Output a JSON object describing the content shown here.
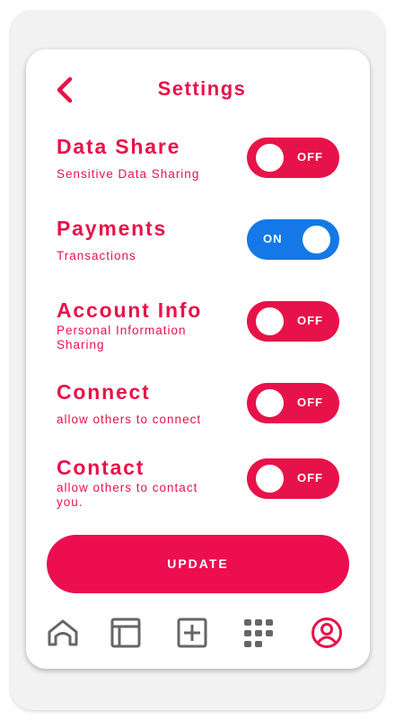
{
  "header": {
    "title": "Settings",
    "back_icon": "chevron-left-icon"
  },
  "settings": [
    {
      "title": "Data Share",
      "subtitle": "Sensitive Data Sharing",
      "state": "OFF"
    },
    {
      "title": "Payments",
      "subtitle": "Transactions",
      "state": "ON"
    },
    {
      "title": "Account Info",
      "subtitle": "Personal Information Sharing",
      "state": "OFF"
    },
    {
      "title": "Connect",
      "subtitle": "allow others to connect",
      "state": "OFF"
    },
    {
      "title": "Contact",
      "subtitle": "allow others to contact you.",
      "state": "OFF"
    }
  ],
  "update_label": "UPDATE",
  "bottom_nav": [
    {
      "icon": "home-icon",
      "active": false
    },
    {
      "icon": "layout-icon",
      "active": false
    },
    {
      "icon": "add-icon",
      "active": false
    },
    {
      "icon": "apps-grid-icon",
      "active": false
    },
    {
      "icon": "profile-icon",
      "active": true
    }
  ],
  "colors": {
    "accent": "#e8124a",
    "on_toggle": "#1479e6",
    "off_toggle": "#e8124a",
    "nav_inactive": "#666666"
  }
}
